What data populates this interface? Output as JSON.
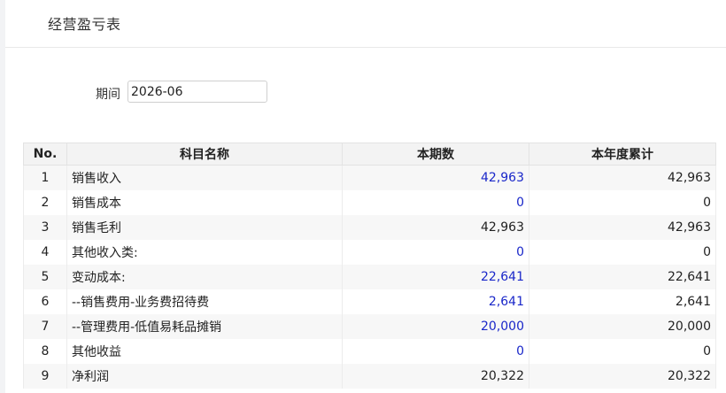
{
  "page": {
    "title": "经营盈亏表"
  },
  "filter": {
    "label": "期间",
    "value": "2026-06"
  },
  "table": {
    "headers": [
      "No.",
      "科目名称",
      "本期数",
      "本年度累计"
    ],
    "rows": [
      {
        "no": "1",
        "name": "销售收入",
        "current": "42,963",
        "current_link": true,
        "ytd": "42,963"
      },
      {
        "no": "2",
        "name": "销售成本",
        "current": "0",
        "current_link": true,
        "ytd": "0"
      },
      {
        "no": "3",
        "name": "销售毛利",
        "current": "42,963",
        "current_link": false,
        "ytd": "42,963"
      },
      {
        "no": "4",
        "name": "其他收入类:",
        "current": "0",
        "current_link": true,
        "ytd": "0"
      },
      {
        "no": "5",
        "name": "变动成本:",
        "current": "22,641",
        "current_link": true,
        "ytd": "22,641"
      },
      {
        "no": "6",
        "name": "--销售费用-业务费招待费",
        "current": "2,641",
        "current_link": true,
        "ytd": "2,641"
      },
      {
        "no": "7",
        "name": "--管理费用-低值易耗品摊销",
        "current": "20,000",
        "current_link": true,
        "ytd": "20,000"
      },
      {
        "no": "8",
        "name": "其他收益",
        "current": "0",
        "current_link": true,
        "ytd": "0"
      },
      {
        "no": "9",
        "name": "净利润",
        "current": "20,322",
        "current_link": false,
        "ytd": "20,322"
      }
    ]
  },
  "colors": {
    "link": "#1a27c9",
    "header_bg": "#f3f3f3",
    "stripe": "#f7f7f7"
  }
}
